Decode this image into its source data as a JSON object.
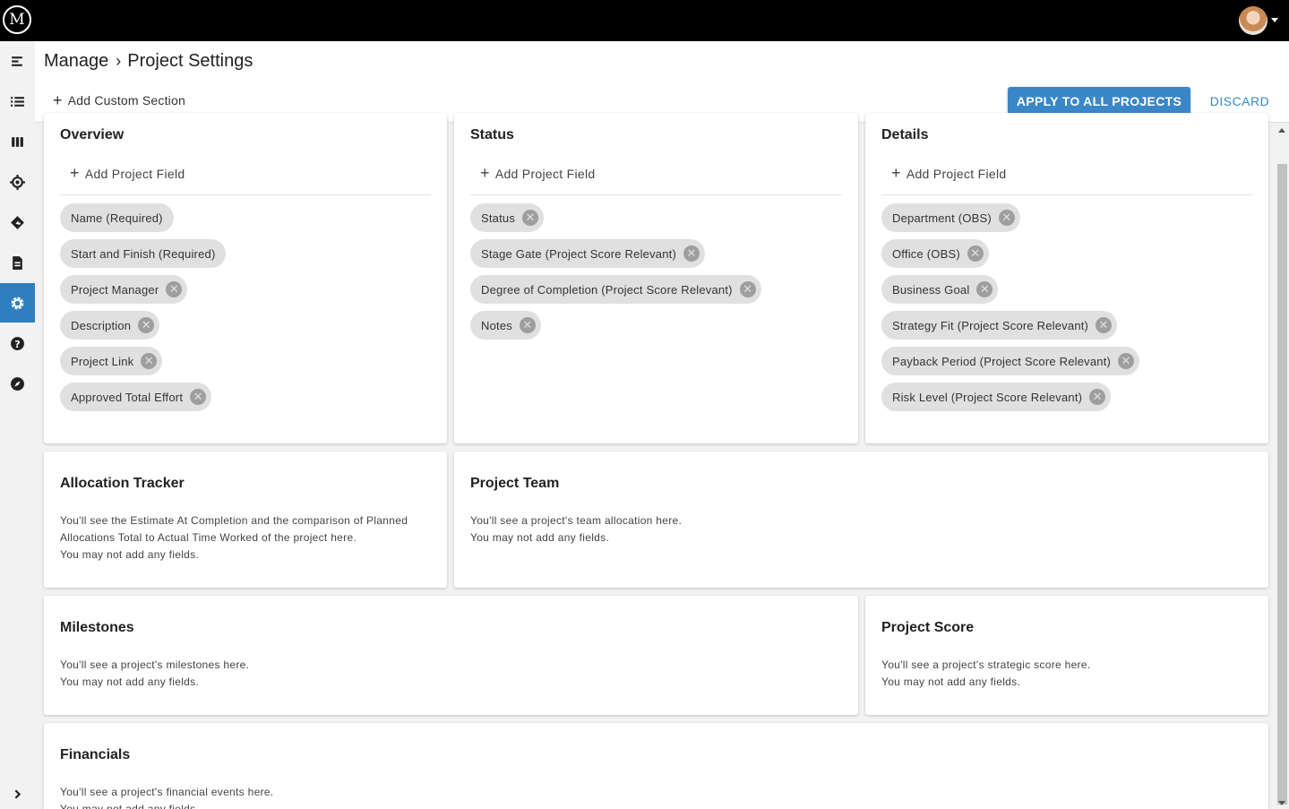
{
  "topbar": {
    "logo_text": "M",
    "logo_icon": "m-logo-icon",
    "avatar_icon": "user-avatar"
  },
  "rail": {
    "items": [
      {
        "icon": "menu-collapse-icon",
        "active": false
      },
      {
        "icon": "list-icon",
        "active": false
      },
      {
        "icon": "columns-icon",
        "active": false
      },
      {
        "icon": "target-icon",
        "active": false
      },
      {
        "icon": "route-icon",
        "active": false
      },
      {
        "icon": "document-icon",
        "active": false
      },
      {
        "icon": "gear-icon",
        "active": true
      },
      {
        "icon": "help-icon",
        "active": false
      },
      {
        "icon": "compass-icon",
        "active": false
      }
    ],
    "expand_icon": "chevron-right-icon"
  },
  "header": {
    "breadcrumb_root": "Manage",
    "breadcrumb_sep": "›",
    "breadcrumb_current": "Project Settings",
    "add_section_plus": "+",
    "add_section_label": "Add Custom Section",
    "apply_label": "APPLY TO ALL PROJECTS",
    "discard_label": "DISCARD"
  },
  "add_field_plus": "+",
  "add_field_label": "Add Project Field",
  "remove_glyph": "✕",
  "sections": {
    "overview": {
      "title": "Overview",
      "chips": [
        "Name (Required)",
        "Start and Finish (Required)",
        "Project Manager",
        "Description",
        "Project Link",
        "Approved Total Effort"
      ]
    },
    "status": {
      "title": "Status",
      "chips": [
        "Status",
        "Stage Gate (Project Score Relevant)",
        "Degree of Completion (Project Score Relevant)",
        "Notes"
      ]
    },
    "details": {
      "title": "Details",
      "chips": [
        "Department (OBS)",
        "Office (OBS)",
        "Business Goal",
        "Strategy Fit (Project Score Relevant)",
        "Payback Period (Project Score Relevant)",
        "Risk Level (Project Score Relevant)"
      ]
    },
    "allocation_tracker": {
      "title": "Allocation Tracker",
      "line1": "You'll see the Estimate At Completion and the comparison of Planned",
      "line2": "Allocations Total to Actual Time Worked of the project here.",
      "line3": "You may not add any fields."
    },
    "project_team": {
      "title": "Project Team",
      "line1": "You'll see a project's team allocation here.",
      "line2": "You may not add any fields."
    },
    "milestones": {
      "title": "Milestones",
      "line1": "You'll see a project's milestones here.",
      "line2": "You may not add any fields."
    },
    "project_score": {
      "title": "Project Score",
      "line1": "You'll see a project's strategic score here.",
      "line2": "You may not add any fields."
    },
    "financials": {
      "title": "Financials",
      "line1": "You'll see a project's financial events here.",
      "line2": "You may not add any fields."
    }
  },
  "colors": {
    "accent": "#3a87c8",
    "topbar": "#000000",
    "chip": "#e0e0e0",
    "rail_active": "#2f7fc0"
  }
}
